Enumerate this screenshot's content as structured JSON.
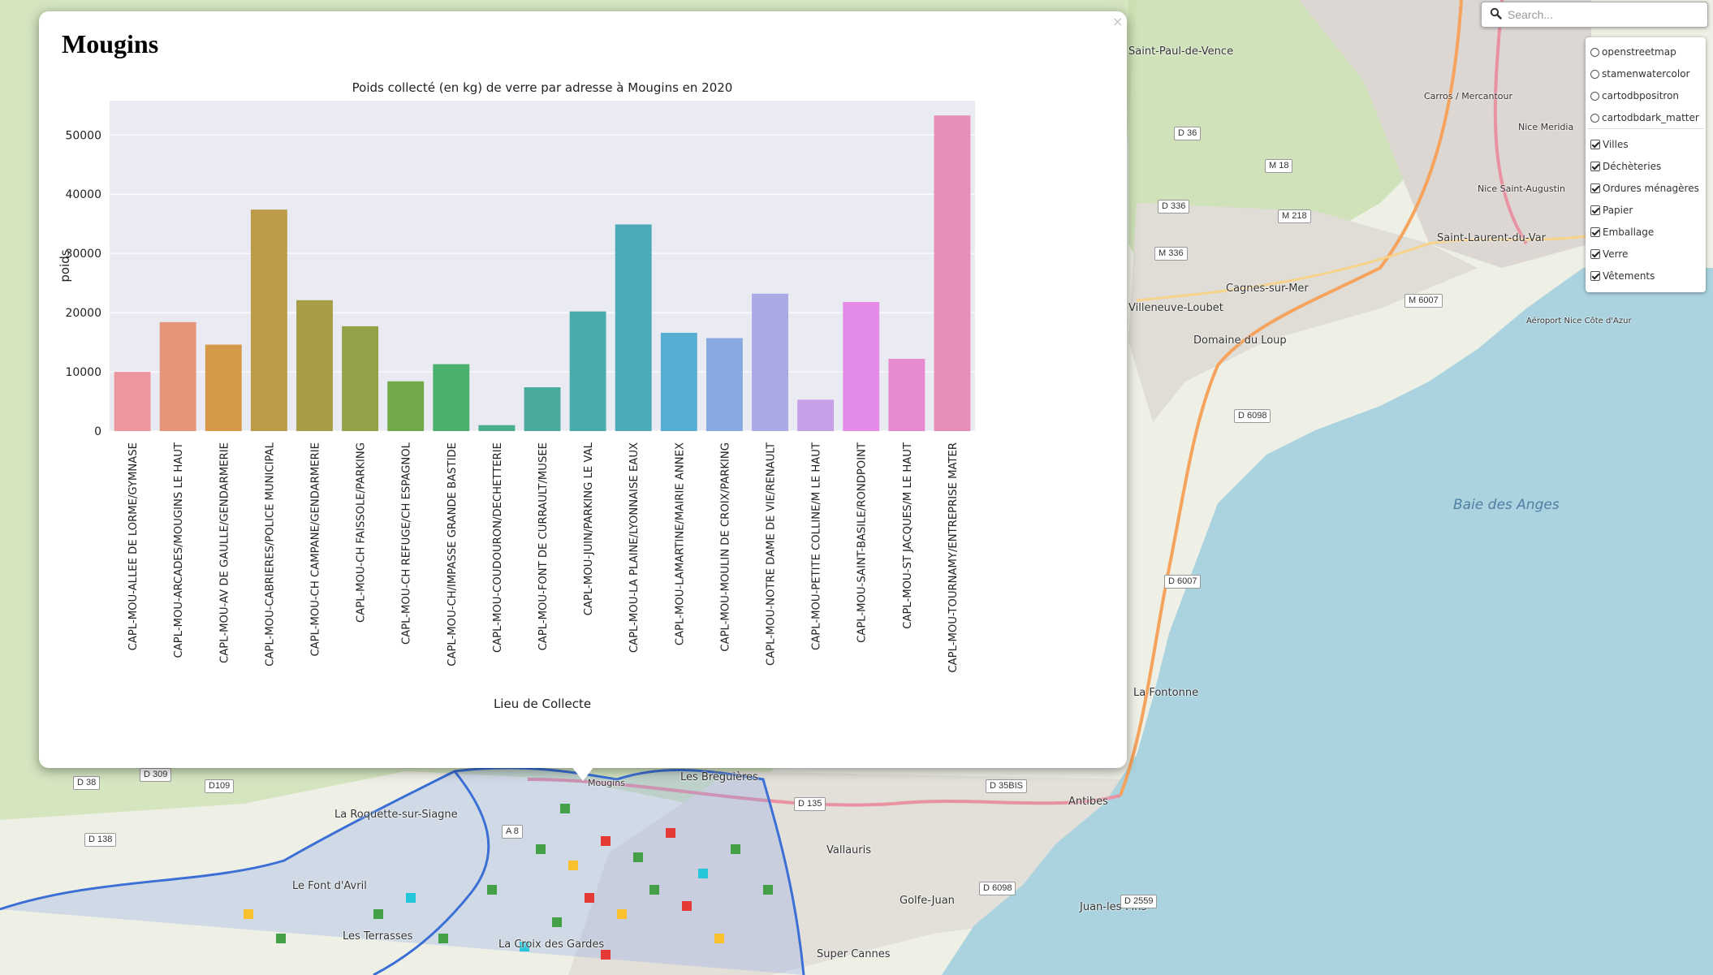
{
  "search": {
    "placeholder": "Search..."
  },
  "layers": {
    "base": [
      "openstreetmap",
      "stamenwatercolor",
      "cartodbpositron",
      "cartodbdark_matter"
    ],
    "overlays": [
      "Villes",
      "Déchèteries",
      "Ordures ménagères",
      "Papier",
      "Emballage",
      "Verre",
      "Vêtements"
    ]
  },
  "popup": {
    "title": "Mougins",
    "close": "×"
  },
  "map_labels": [
    "Saint-Paul-de-Vence",
    "Saint-Laurent-du-Var",
    "Cagnes-sur-Mer",
    "Villeneuve-Loubet",
    "Domaine du Loup",
    "Baie des Anges",
    "Antibes",
    "Vallauris",
    "Golfe-Juan",
    "Juan-les-Pins",
    "La Fontonne",
    "Mougins",
    "Les Bréguières",
    "La Roquette-sur-Siagne",
    "Le Font d'Avril",
    "Les Terrasses",
    "Super Cannes",
    "La Croix des Gardes",
    "Carros / Mercantour",
    "Nice Meridia",
    "Aéroport Nice Côte d'Azur",
    "Nice Saint-Augustin"
  ],
  "road_labels": [
    "D 36",
    "M 18",
    "D 336",
    "M 218",
    "M 336",
    "M 6007",
    "D 6098",
    "D 6007",
    "D 309",
    "D 38",
    "D109",
    "D 138",
    "D 135",
    "D 35BIS",
    "D 6098",
    "D 2559",
    "A 8"
  ],
  "colors": {
    "plot_bg": "#EAEAF2",
    "accent_sea": "#aad3df"
  },
  "chart_data": {
    "type": "bar",
    "title": "Poids collecté (en kg) de verre par adresse à Mougins en 2020",
    "xlabel": "Lieu de Collecte",
    "ylabel": "poids",
    "ylim": [
      0,
      55800
    ],
    "yticks": [
      0,
      10000,
      20000,
      30000,
      40000,
      50000
    ],
    "grid": true,
    "categories": [
      "CAPL-MOU-ALLEE DE LORME/GYMNASE",
      "CAPL-MOU-ARCADES/MOUGINS LE HAUT",
      "CAPL-MOU-AV DE GAULLE/GENDARMERIE",
      "CAPL-MOU-CABRIERES/POLICE MUNICIPAL",
      "CAPL-MOU-CH CAMPANE/GENDARMERIE",
      "CAPL-MOU-CH FAISSOLE/PARKING",
      "CAPL-MOU-CH REFUGE/CH ESPAGNOL",
      "CAPL-MOU-CH/IMPASSE GRANDE BASTIDE",
      "CAPL-MOU-COUDOURON/DECHETTERIE",
      "CAPL-MOU-FONT DE CURRAULT/MUSEE",
      "CAPL-MOU-JUIN/PARKING LE VAL",
      "CAPL-MOU-LA PLAINE/LYONNAISE EAUX",
      "CAPL-MOU-LAMARTINE/MAIRIE ANNEX",
      "CAPL-MOU-MOULIN DE CROIX/PARKING",
      "CAPL-MOU-NOTRE DAME DE VIE/RENAULT",
      "CAPL-MOU-PETITE COLLINE/M LE HAUT",
      "CAPL-MOU-SAINT-BASILE/RONDPOINT",
      "CAPL-MOU-ST JACQUES/M LE HAUT",
      "CAPL-MOU-TOURNAMY/ENTREPRISE MATER"
    ],
    "values": [
      10000,
      18400,
      14600,
      37400,
      22100,
      17700,
      8400,
      11300,
      1000,
      7400,
      20200,
      34900,
      16600,
      15700,
      23200,
      5300,
      21800,
      12200,
      53300
    ],
    "bar_colors": [
      "#ed969e",
      "#e6957a",
      "#d59849",
      "#bc9b48",
      "#a79d47",
      "#95a147",
      "#72aa49",
      "#4ab06c",
      "#4aad8c",
      "#4aab9c",
      "#4aabab",
      "#4daab8",
      "#56aed3",
      "#87a9e0",
      "#aba8e6",
      "#c5a0e6",
      "#e38be6",
      "#e78ad0",
      "#e78fba"
    ]
  }
}
